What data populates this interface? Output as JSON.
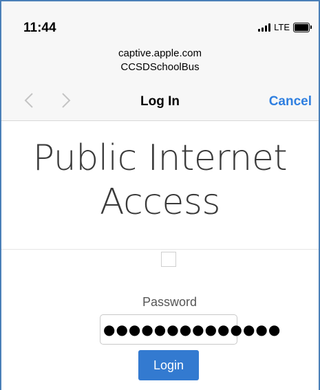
{
  "status_bar": {
    "time": "11:44",
    "network": "LTE",
    "icons": [
      "signal-icon",
      "battery-icon"
    ]
  },
  "address": {
    "host": "captive.apple.com",
    "network_name": "CCSDSchoolBus"
  },
  "nav": {
    "back_icon": "chevron-left-icon",
    "forward_icon": "chevron-right-icon",
    "title": "Log In",
    "cancel_label": "Cancel"
  },
  "page": {
    "heading_line1": "Public Internet",
    "heading_line2": "Access",
    "password_label": "Password",
    "password_value": "●●●●●●●●●●●●●●",
    "login_label": "Login"
  },
  "colors": {
    "accent": "#2f7fe0",
    "button": "#337ad0"
  }
}
